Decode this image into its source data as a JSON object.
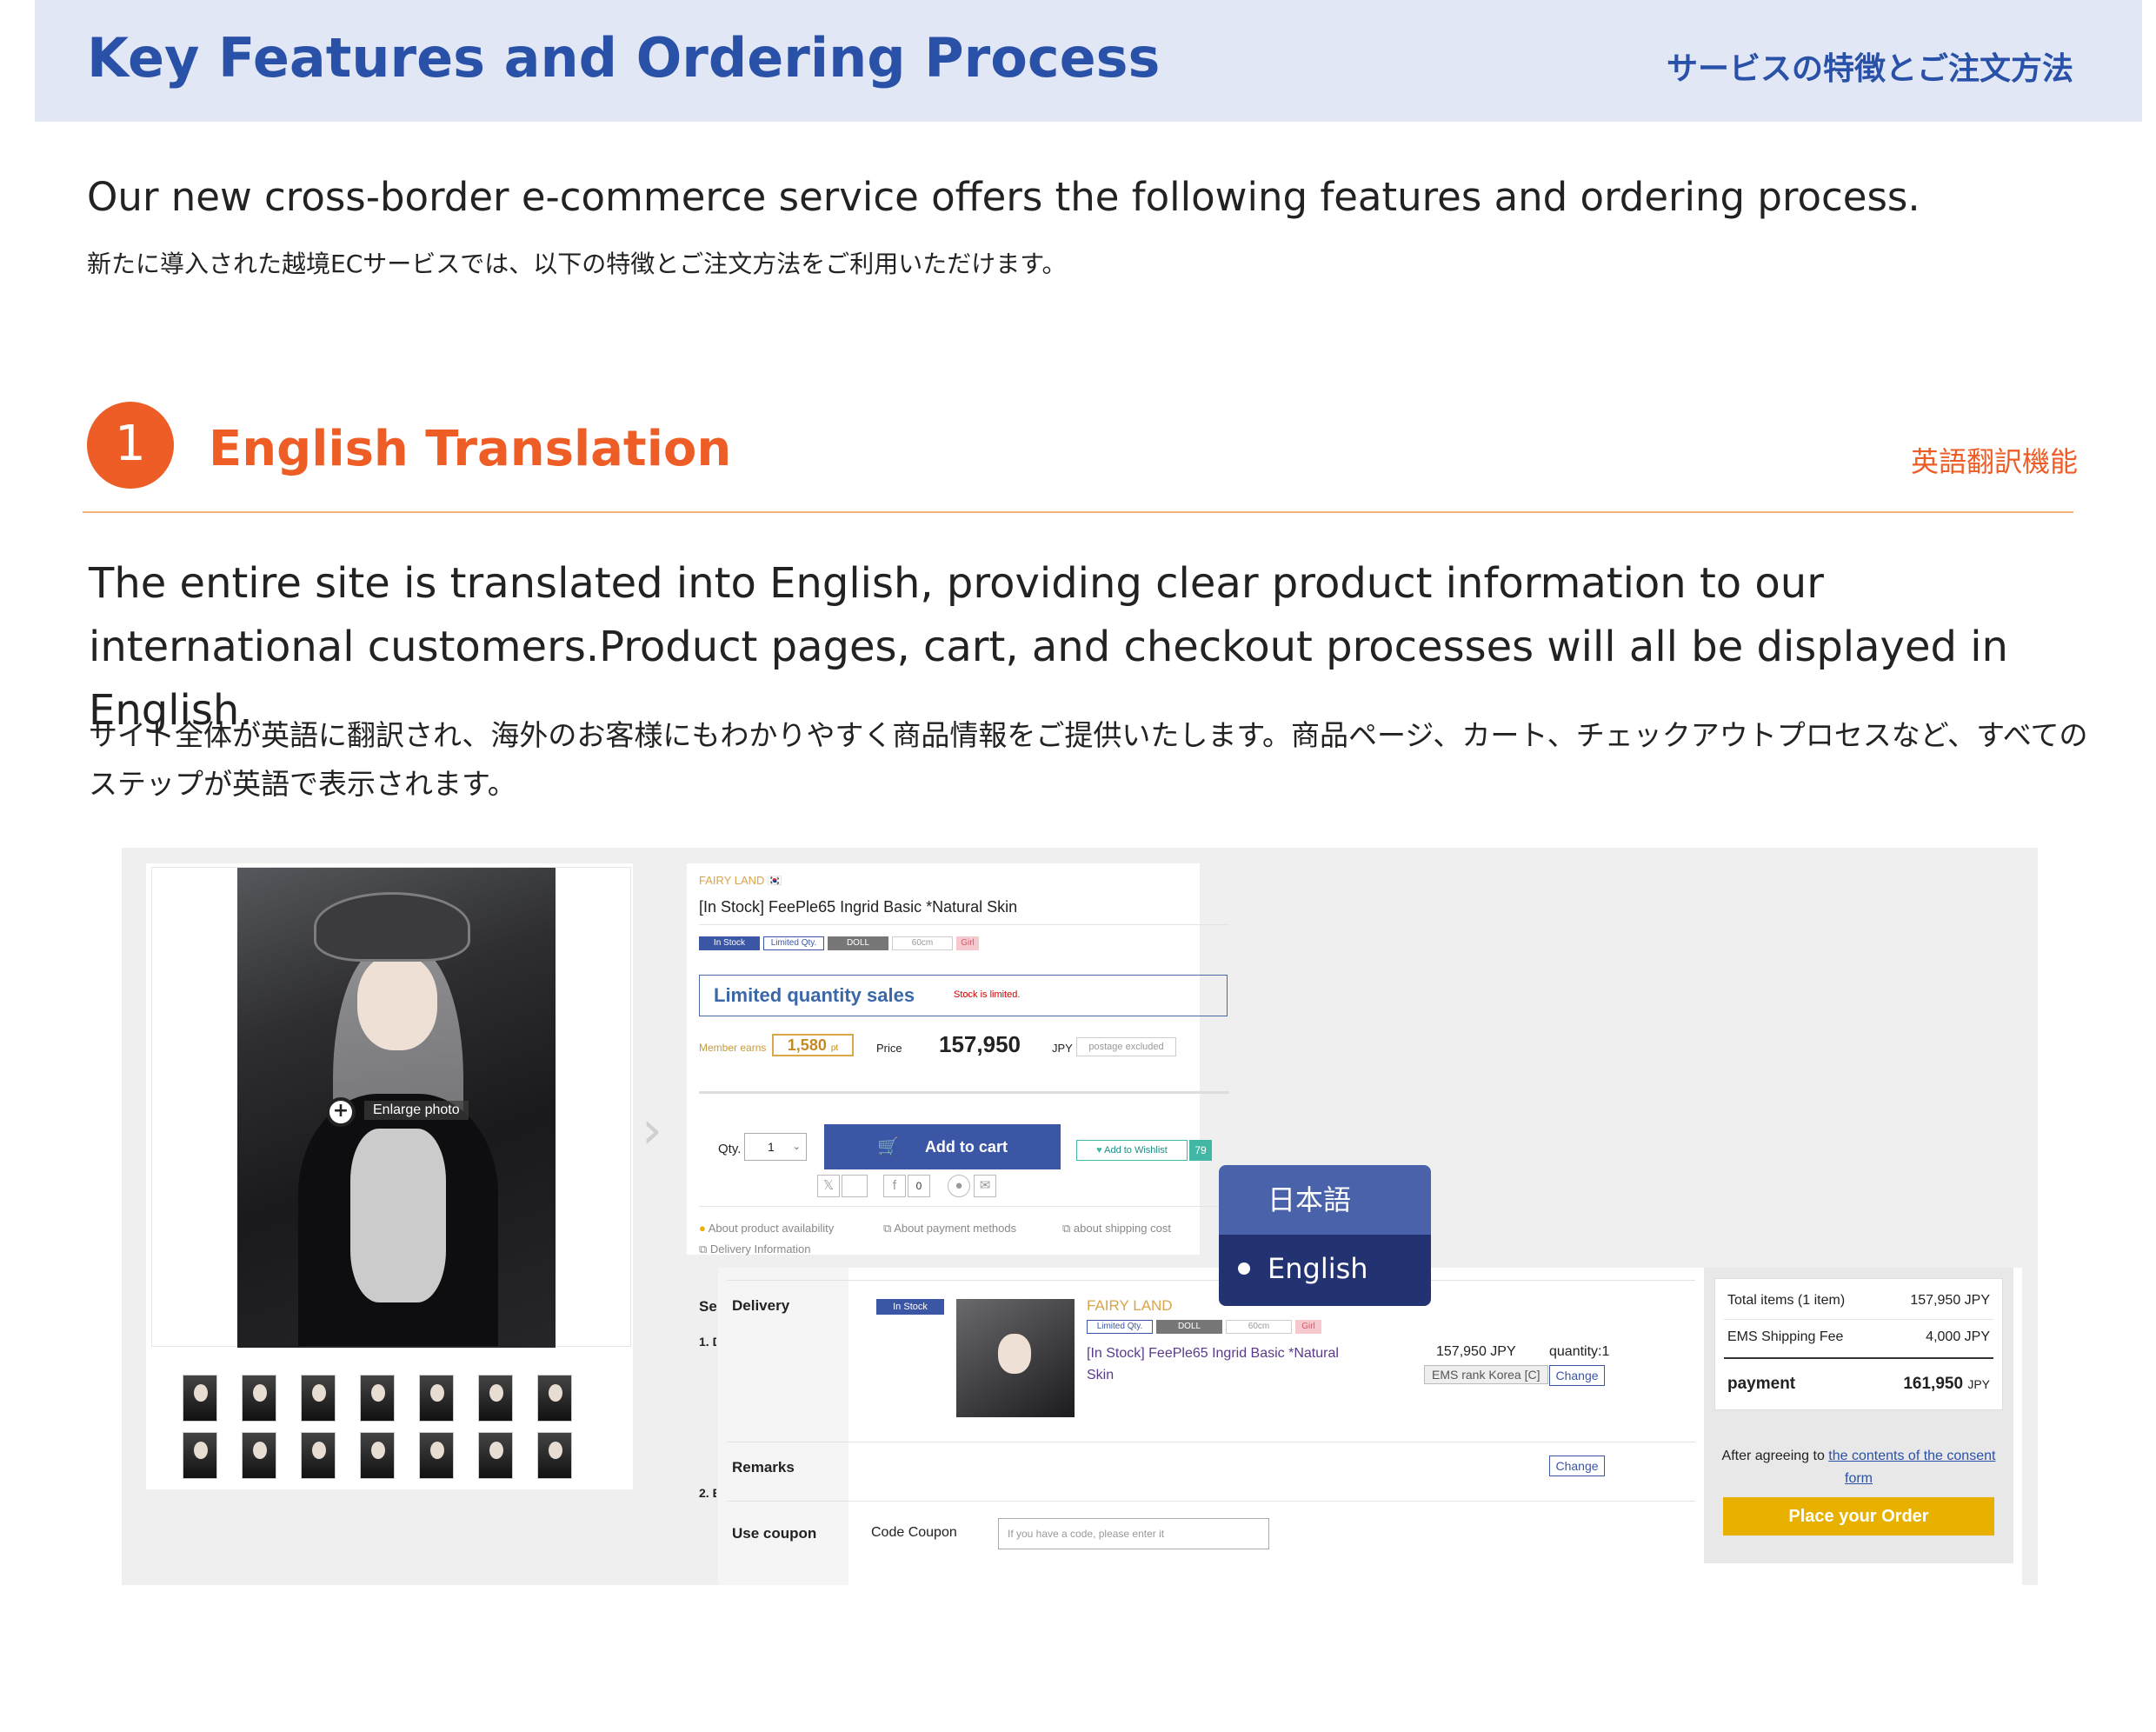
{
  "header": {
    "title": "Key Features and Ordering Process",
    "subtitle_jp": "サービスの特徴とご注文方法"
  },
  "intro": {
    "en": "Our new cross-border e-commerce service offers the following features and ordering process.",
    "jp": "新たに導入された越境ECサービスでは、以下の特徴とご注文方法をご利用いただけます。"
  },
  "section1": {
    "number": "1",
    "title": "English Translation",
    "subtitle_jp": "英語翻訳機能",
    "body_en": "The entire site is translated into English, providing clear product information to our international customers.Product pages, cart, and checkout processes will all be displayed in English.",
    "body_jp": "サイト全体が英語に翻訳され、海外のお客様にもわかりやすく商品情報をご提供いたします。商品ページ、カート、チェックアウトプロセスなど、すべてのステップが英語で表示されます。"
  },
  "product": {
    "brand": "FAIRY LAND",
    "flag": "🇰🇷",
    "title": "[In Stock] FeePle65 Ingrid Basic *Natural Skin",
    "tags": [
      "In Stock",
      "Limited Qty.",
      "DOLL",
      "60cm",
      "Girl"
    ],
    "limited_label": "Limited quantity sales",
    "stock_note": "Stock is limited.",
    "member_label": "Member earns",
    "points": "1,580",
    "points_unit": "pt",
    "price_label": "Price",
    "price": "157,950",
    "currency": "JPY",
    "postage": "postage excluded",
    "qty_label": "Qty.",
    "qty_value": "1",
    "add_to_cart": "Add to cart",
    "wishlist": "Add to Wishlist",
    "wishlist_count": "79",
    "fb_count": "0",
    "enlarge": "Enlarge photo",
    "about_availability": "About product availability",
    "about_payment": "About payment methods",
    "about_shipping": "about shipping cost",
    "delivery_info": "Delivery Information"
  },
  "language_menu": {
    "options": [
      "日本語",
      "English"
    ],
    "selected": "English"
  },
  "checkout": {
    "cut_label": "Set",
    "cut_step1": "1. D",
    "cut_step2": "2. E",
    "delivery_label": "Delivery",
    "in_stock": "In Stock",
    "brand": "FAIRY LAND",
    "tags": [
      "Limited Qty.",
      "DOLL",
      "60cm",
      "Girl"
    ],
    "item_title": "[In Stock] FeePle65 Ingrid Basic *Natural Skin",
    "item_price": "157,950 JPY",
    "shipping_rank": "EMS rank Korea [C]",
    "quantity": "quantity:1",
    "change": "Change",
    "remarks_label": "Remarks",
    "coupon_label": "Use coupon",
    "code_coupon": "Code Coupon",
    "coupon_placeholder": "If you have a code, please enter it"
  },
  "summary": {
    "total_items_label": "Total items (1 item)",
    "total_items_value": "157,950 JPY",
    "shipping_label": "EMS Shipping Fee",
    "shipping_value": "4,000 JPY",
    "payment_label": "payment",
    "payment_value": "161,950",
    "payment_currency": "JPY",
    "agree_prefix": "After agreeing to",
    "agree_link": "the contents of the consent form",
    "place_order": "Place your Order"
  },
  "colors": {
    "header_bg": "#e1e7f5",
    "header_text": "#2a51a8",
    "accent_orange": "#ee5d26",
    "button_blue": "#3b56a4",
    "order_gold": "#e8b100",
    "lang_menu_dark": "#233372"
  }
}
